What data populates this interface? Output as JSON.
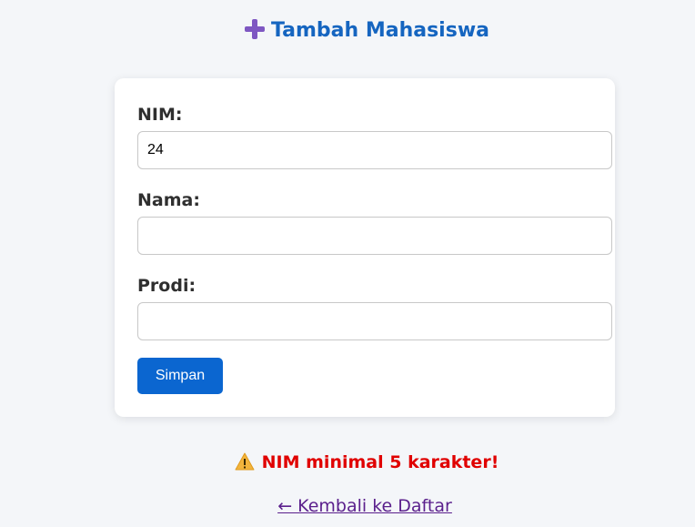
{
  "header": {
    "title": "Tambah Mahasiswa",
    "icon": "plus-icon",
    "icon_color": "#7e57c2",
    "title_color": "#1565c0"
  },
  "form": {
    "nim_label": "NIM:",
    "nim_value": "24",
    "nama_label": "Nama:",
    "nama_value": "",
    "prodi_label": "Prodi:",
    "prodi_value": "",
    "submit_label": "Simpan",
    "submit_color": "#0b66d0"
  },
  "message": {
    "icon": "warning-icon",
    "text": "NIM minimal 5 karakter!",
    "color": "#e00000"
  },
  "back_link": {
    "text": "← Kembali ke Daftar",
    "color": "#5a1f8c"
  }
}
